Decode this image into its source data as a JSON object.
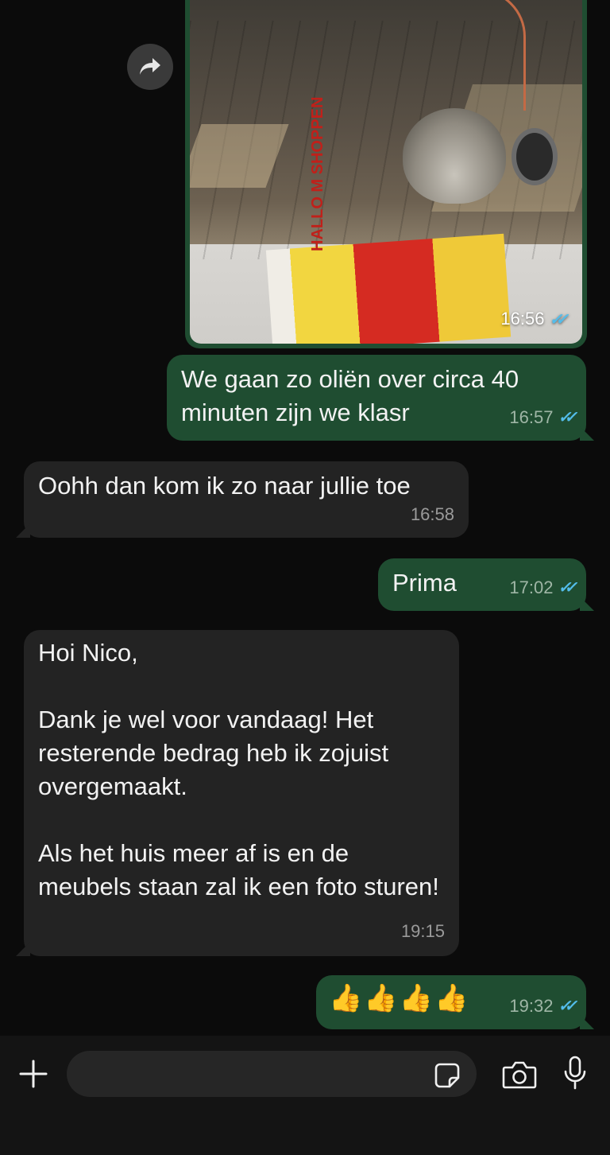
{
  "photo": {
    "time": "16:56",
    "flyer_text": "HALLO M SHOPPEN"
  },
  "messages": [
    {
      "dir": "out",
      "text": "We gaan zo oliën over circa 40 minuten zijn we klasr",
      "time": "16:57"
    },
    {
      "dir": "in",
      "text": "Oohh dan kom ik zo naar jullie toe",
      "time": "16:58"
    },
    {
      "dir": "out",
      "text": "Prima",
      "time": "17:02"
    },
    {
      "dir": "in",
      "text": "Hoi Nico,\n\nDank je wel voor vandaag! Het resterende bedrag heb ik zojuist overgemaakt.\n\nAls het huis meer af is en de meubels staan zal ik een foto sturen!",
      "time": "19:15"
    },
    {
      "dir": "out",
      "text": "👍👍👍👍",
      "time": "19:32"
    }
  ],
  "read_ticks": "✓✓",
  "icons": {
    "forward": "forward-arrow-icon",
    "plus": "plus-icon",
    "sticker": "sticker-icon",
    "camera": "camera-icon",
    "mic": "microphone-icon"
  },
  "colors": {
    "background": "#0b0b0b",
    "outgoing_bubble": "#1f4d31",
    "incoming_bubble": "#232323",
    "read_ticks": "#53bdeb",
    "input_bar": "#141414"
  }
}
